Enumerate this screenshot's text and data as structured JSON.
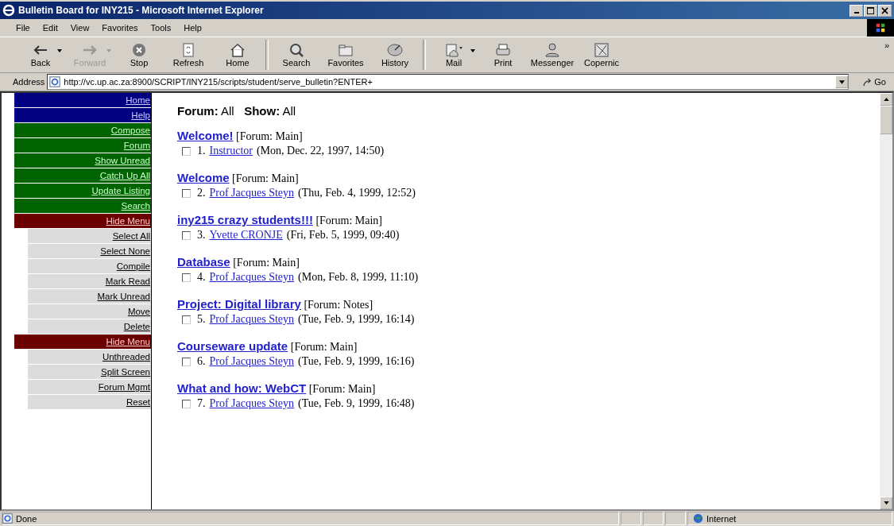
{
  "window": {
    "title": "Bulletin Board for INY215 - Microsoft Internet Explorer"
  },
  "menu_bar": [
    "File",
    "Edit",
    "View",
    "Favorites",
    "Tools",
    "Help"
  ],
  "toolbar": [
    {
      "label": "Back",
      "dropdown": true,
      "disabled": false
    },
    {
      "label": "Forward",
      "dropdown": true,
      "disabled": true
    },
    {
      "label": "Stop",
      "dropdown": false,
      "disabled": false
    },
    {
      "label": "Refresh",
      "dropdown": false,
      "disabled": false
    },
    {
      "label": "Home",
      "dropdown": false,
      "disabled": false
    },
    {
      "label": "Search",
      "dropdown": false,
      "disabled": false
    },
    {
      "label": "Favorites",
      "dropdown": false,
      "disabled": false
    },
    {
      "label": "History",
      "dropdown": false,
      "disabled": false
    },
    {
      "label": "Mail",
      "dropdown": true,
      "disabled": false
    },
    {
      "label": "Print",
      "dropdown": false,
      "disabled": false
    },
    {
      "label": "Messenger",
      "dropdown": false,
      "disabled": false
    },
    {
      "label": "Copernic",
      "dropdown": false,
      "disabled": false
    }
  ],
  "toolbar_overflow": "»",
  "address_bar": {
    "label": "Address",
    "value": "http://vc.up.ac.za:8900/SCRIPT/INY215/scripts/student/serve_bulletin?ENTER+",
    "go": "Go"
  },
  "sidebar": {
    "items": [
      {
        "label": "Home",
        "kind": "nav"
      },
      {
        "label": "Help",
        "kind": "nav"
      },
      {
        "label": "Compose",
        "kind": "action"
      },
      {
        "label": "Forum",
        "kind": "action"
      },
      {
        "label": "Show Unread",
        "kind": "action"
      },
      {
        "label": "Catch Up All",
        "kind": "action"
      },
      {
        "label": "Update Listing",
        "kind": "action"
      },
      {
        "label": "Search",
        "kind": "action"
      },
      {
        "label": "Hide Menu",
        "kind": "hide"
      },
      {
        "label": "Select All",
        "kind": "tool"
      },
      {
        "label": "Select None",
        "kind": "tool"
      },
      {
        "label": "Compile",
        "kind": "tool"
      },
      {
        "label": "Mark Read",
        "kind": "tool"
      },
      {
        "label": "Mark Unread",
        "kind": "tool"
      },
      {
        "label": "Move",
        "kind": "tool"
      },
      {
        "label": "Delete",
        "kind": "tool"
      },
      {
        "label": "Hide Menu",
        "kind": "hide"
      },
      {
        "label": "Unthreaded",
        "kind": "tool"
      },
      {
        "label": "Split Screen",
        "kind": "tool"
      },
      {
        "label": "Forum Mgmt",
        "kind": "tool"
      },
      {
        "label": "Reset",
        "kind": "tool"
      }
    ]
  },
  "filter": {
    "forum_label": "Forum:",
    "forum_value": "All",
    "show_label": "Show:",
    "show_value": "All"
  },
  "posts": [
    {
      "title": "Welcome!",
      "forum": "[Forum: Main]",
      "number": "1.",
      "author": "Instructor",
      "date": "(Mon, Dec. 22, 1997, 14:50)",
      "checked": false
    },
    {
      "title": "Welcome",
      "forum": "[Forum: Main]",
      "number": "2.",
      "author": "Prof Jacques Steyn",
      "date": "(Thu, Feb. 4, 1999, 12:52)",
      "checked": false
    },
    {
      "title": "iny215 crazy students!!!",
      "forum": "[Forum: Main]",
      "number": "3.",
      "author": "Yvette CRONJE",
      "date": "(Fri, Feb. 5, 1999, 09:40)",
      "checked": false
    },
    {
      "title": "Database",
      "forum": "[Forum: Main]",
      "number": "4.",
      "author": "Prof Jacques Steyn",
      "date": "(Mon, Feb. 8, 1999, 11:10)",
      "checked": false
    },
    {
      "title": "Project: Digital library",
      "forum": "[Forum: Notes]",
      "number": "5.",
      "author": "Prof Jacques Steyn",
      "date": "(Tue, Feb. 9, 1999, 16:14)",
      "checked": false
    },
    {
      "title": "Courseware update",
      "forum": "[Forum: Main]",
      "number": "6.",
      "author": "Prof Jacques Steyn",
      "date": "(Tue, Feb. 9, 1999, 16:16)",
      "checked": false
    },
    {
      "title": "What and how: WebCT",
      "forum": "[Forum: Main]",
      "number": "7.",
      "author": "Prof Jacques Steyn",
      "date": "(Tue, Feb. 9, 1999, 16:48)",
      "checked": false
    }
  ],
  "status_bar": {
    "status": "Done",
    "zone": "Internet"
  }
}
